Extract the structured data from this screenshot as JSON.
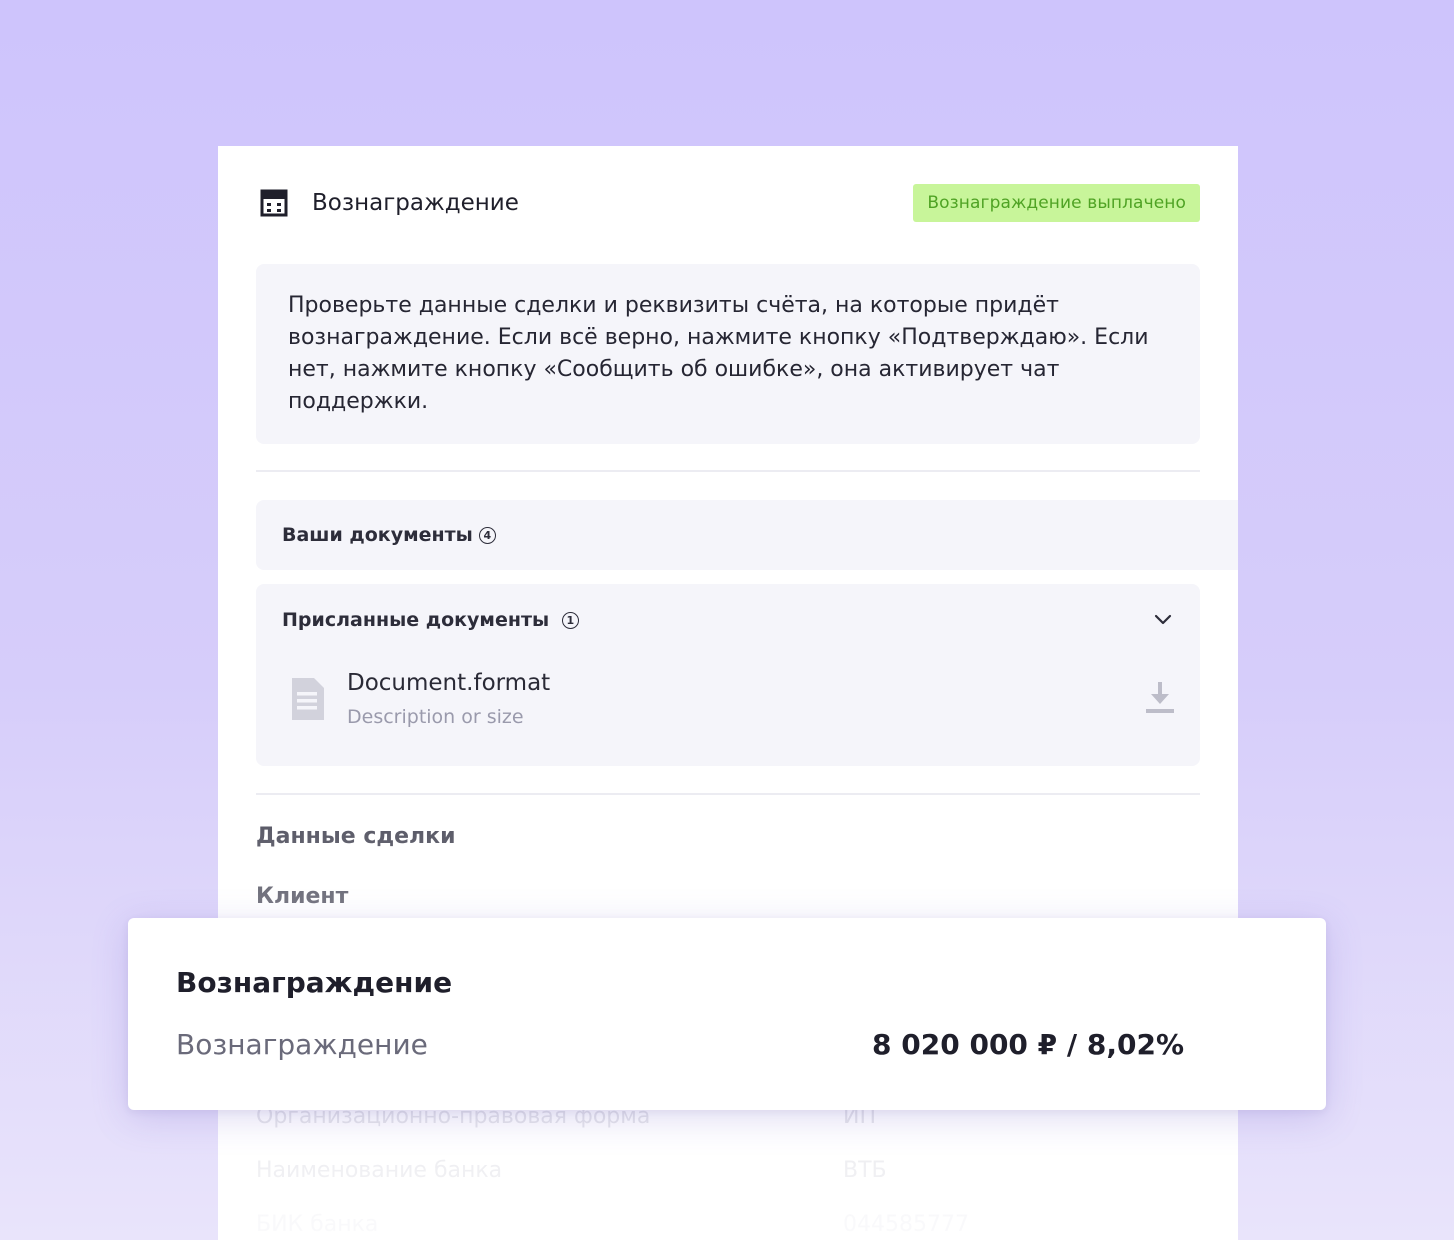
{
  "card": {
    "title": "Вознаграждение",
    "title_icon": "calculator-icon",
    "status_badge": "Вознаграждение выплачено",
    "notice": "Проверьте данные сделки и реквизиты счёта, на которые придёт вознаграждение. Если всё верно, нажмите кнопку «Подтверждаю». Если нет, нажмите кнопку «Сообщить об ошибке», она активирует чат поддержки."
  },
  "documents": {
    "section_label": "Ваши документы",
    "section_count": "4",
    "received_label": "Присланные документы",
    "received_count": "1",
    "expand_icon": "chevron-down-icon",
    "items": [
      {
        "name": "Document.format",
        "description": "Description or size",
        "icon": "document-icon",
        "action_icon": "download-icon"
      }
    ]
  },
  "deal": {
    "section_title": "Данные сделки",
    "client_label": "Клиент",
    "rows": [
      {
        "label": "Организационно-правовая форма",
        "value": "ИП"
      },
      {
        "label": "Наименование банка",
        "value": "ВТБ"
      },
      {
        "label": "БИК банка",
        "value": "044585777"
      }
    ]
  },
  "popup": {
    "title": "Вознаграждение",
    "label": "Вознаграждение",
    "value": "8 020 000 ₽ / 8,02%"
  },
  "colors": {
    "background": "#cec4fc",
    "badge_bg": "#c8f59a",
    "badge_text": "#4fa324",
    "panel_bg": "#f5f5fa"
  }
}
